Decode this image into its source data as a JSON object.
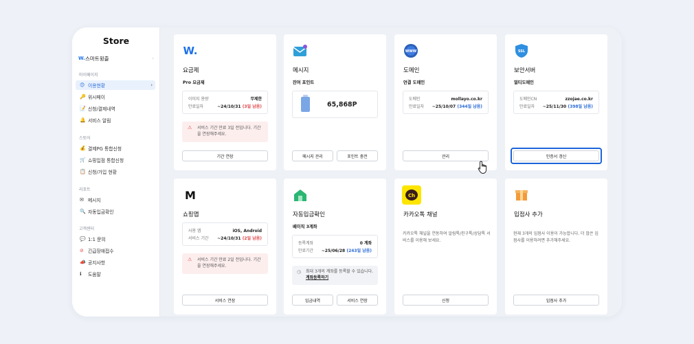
{
  "sidebar": {
    "title": "Store",
    "shop": {
      "logo": "W.",
      "label": "스마트윙즐",
      "chevron": "›"
    },
    "sections": [
      {
        "label": "마이페이지",
        "items": [
          {
            "icon": "😊",
            "label": "이용현황",
            "active": true,
            "chevron": "›"
          },
          {
            "icon": "🔑",
            "label": "위시페이"
          },
          {
            "icon": "📝",
            "label": "신청/결제내역"
          },
          {
            "icon": "🔔",
            "label": "서비스 알림"
          }
        ]
      },
      {
        "label": "스토어",
        "items": [
          {
            "icon": "💰",
            "label": "결제PG 통합신청"
          },
          {
            "icon": "🛒",
            "label": "쇼핑입점 통합신청"
          },
          {
            "icon": "📋",
            "label": "신청/가입 현황"
          }
        ]
      },
      {
        "label": "리포트",
        "items": [
          {
            "icon": "✉",
            "label": "메시지"
          },
          {
            "icon": "🔍",
            "label": "자동입금확인"
          }
        ]
      },
      {
        "label": "고객센터",
        "items": [
          {
            "icon": "💬",
            "label": "1:1 문의"
          },
          {
            "icon": "⊘",
            "label": "긴급장애접수"
          },
          {
            "icon": "📣",
            "label": "공지사항"
          },
          {
            "icon": "ℹ",
            "label": "도움말"
          }
        ]
      }
    ]
  },
  "cards": {
    "plan": {
      "title": "요금제",
      "sub": "Pro 요금제",
      "rows": [
        {
          "label": "이미지 용량",
          "value": "무제한"
        },
        {
          "label": "만료일자",
          "value": "~24/10/31",
          "extra": "(3일 남음)"
        }
      ],
      "warning": "서비스 기간 만료 3일 전입니다. 기간을 연장해주세요.",
      "button": "기간 연장"
    },
    "message": {
      "title": "메시지",
      "sub": "잔여 포인트",
      "points": "65,868P",
      "button1": "메시지 관리",
      "button2": "포인트 충전"
    },
    "domain": {
      "title": "도메인",
      "sub": "연결 도메인",
      "rows": [
        {
          "label": "도메인",
          "value": "mollayo.co.kr"
        },
        {
          "label": "만료일자",
          "value": "~25/10/07",
          "extra": "(344일 남음)"
        }
      ],
      "button": "관리"
    },
    "ssl": {
      "title": "보안서버",
      "sub": "멀티도메인",
      "rows": [
        {
          "label": "도메인CN",
          "value": "zzojae.co.kr"
        },
        {
          "label": "만료일자",
          "value": "~25/11/30",
          "extra": "(398일 남음)"
        }
      ],
      "button": "인증서 갱신"
    },
    "shopping": {
      "title": "쇼핑앱",
      "rows": [
        {
          "label": "사용 앱",
          "value": "iOS, Android"
        },
        {
          "label": "서비스 기간",
          "value": "~24/10/31",
          "extra": "(2일 남음)"
        }
      ],
      "warning": "서비스 기간 만료 2일 전입니다. 기간을 연장해주세요.",
      "button": "서비스 연장"
    },
    "deposit": {
      "title": "자동입금확인",
      "sub": "베이직 3계좌",
      "rows": [
        {
          "label": "등록계좌",
          "value": "0 계좌"
        },
        {
          "label": "만료기간",
          "value": "~25/06/28",
          "extra": "(243일 남음)"
        }
      ],
      "note": "최대 3개의 계좌를 등록할 수 있습니다.",
      "note_link": "계좌등록하기",
      "button1": "입금내역",
      "button2": "서비스 연장"
    },
    "kakao": {
      "title": "카카오톡 채널",
      "desc": "카카오톡 채널을 연동하여 알림톡/친구톡/상담톡 서비스를 이용해 보세요.",
      "button": "신청",
      "logo": "Ch"
    },
    "store_add": {
      "title": "입점사 추가",
      "desc": "현재 3개의 입점사 이용이 가능합니다. 더 많은 입점사를 이용하려면 추가해주세요.",
      "button": "입점사 추가"
    }
  },
  "icons": {
    "plan": "W.",
    "shopping": "M",
    "ssl": "SSL",
    "domain": "WWW"
  }
}
